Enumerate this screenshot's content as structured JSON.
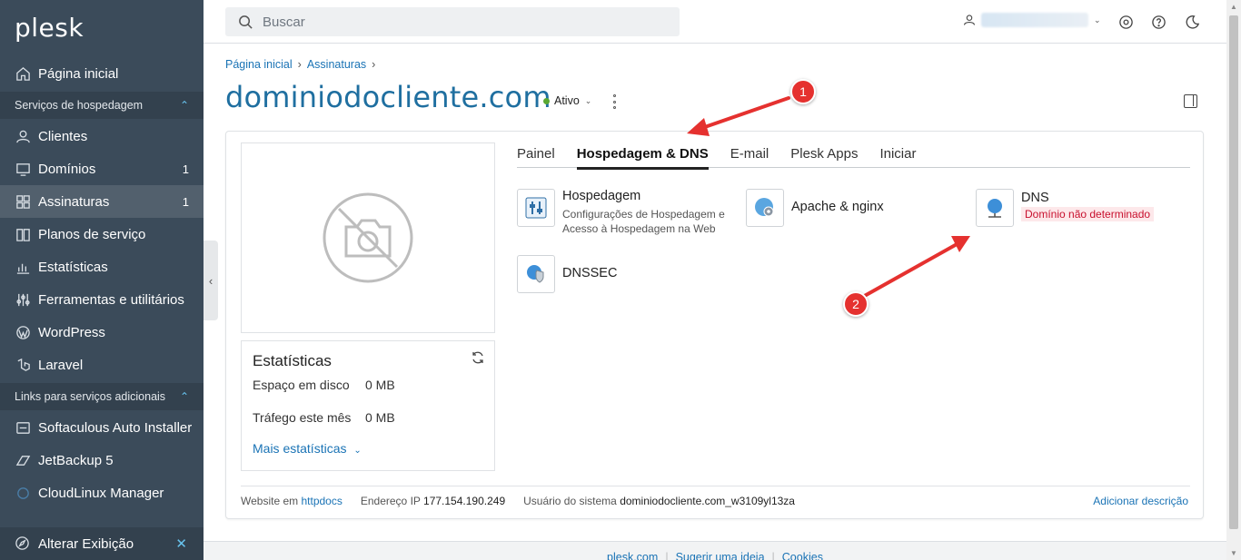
{
  "brand": "plesk",
  "sidebar": {
    "items": [
      {
        "label": "Página inicial",
        "icon": "home-icon"
      },
      {
        "label": "Clientes",
        "icon": "user-icon"
      },
      {
        "label": "Domínios",
        "icon": "monitor-icon",
        "count": "1"
      },
      {
        "label": "Assinaturas",
        "icon": "grid-icon",
        "count": "1"
      },
      {
        "label": "Planos de serviço",
        "icon": "book-icon"
      },
      {
        "label": "Estatísticas",
        "icon": "bar-chart-icon"
      },
      {
        "label": "Ferramentas e utilitários",
        "icon": "sliders-icon"
      },
      {
        "label": "WordPress",
        "icon": "wordpress-icon"
      },
      {
        "label": "Laravel",
        "icon": "laravel-icon"
      },
      {
        "label": "Softaculous Auto Installer",
        "icon": "softaculous-icon"
      },
      {
        "label": "JetBackup 5",
        "icon": "jetbackup-icon"
      },
      {
        "label": "CloudLinux Manager",
        "icon": "cloudlinux-icon"
      }
    ],
    "sections": {
      "hosting": "Serviços de hospedagem",
      "links": "Links para serviços adicionais"
    },
    "bottom": "Alterar Exibição",
    "active_color": "#52606d",
    "bg_color": "#3b4b5a"
  },
  "topbar": {
    "search_placeholder": "Buscar"
  },
  "breadcrumb": [
    "Página inicial",
    "Assinaturas"
  ],
  "page": {
    "title": "dominiodocliente.com",
    "status": "Ativo"
  },
  "stats": {
    "title": "Estatísticas",
    "disk_label": "Espaço em disco",
    "disk_value": "0 MB",
    "traffic_label": "Tráfego este mês",
    "traffic_value": "0 MB",
    "more": "Mais estatísticas"
  },
  "tabs": [
    "Painel",
    "Hospedagem & DNS",
    "E-mail",
    "Plesk Apps",
    "Iniciar"
  ],
  "tools": {
    "hosting": {
      "name": "Hospedagem",
      "desc1": "Configurações de Hospedagem e",
      "desc2": "Acesso à Hospedagem na Web"
    },
    "apache": {
      "name": "Apache & nginx"
    },
    "dns": {
      "name": "DNS",
      "warning": "Domínio não determinado"
    },
    "dnssec": {
      "name": "DNSSEC"
    }
  },
  "footer_info": {
    "website_label": "Website em",
    "website_value": "httpdocs",
    "ip_label": "Endereço IP",
    "ip_value": "177.154.190.249",
    "user_label": "Usuário do sistema",
    "user_value": "dominiodocliente.com_w3109yl13za",
    "add_desc": "Adicionar descrição"
  },
  "page_footer": [
    "plesk.com",
    "Sugerir uma ideia",
    "Cookies"
  ],
  "annotations": [
    "1",
    "2"
  ],
  "colors": {
    "accent": "#1a73b5",
    "title": "#1f6fa0",
    "annotation": "#e5312f",
    "warning": "#c8102e"
  }
}
